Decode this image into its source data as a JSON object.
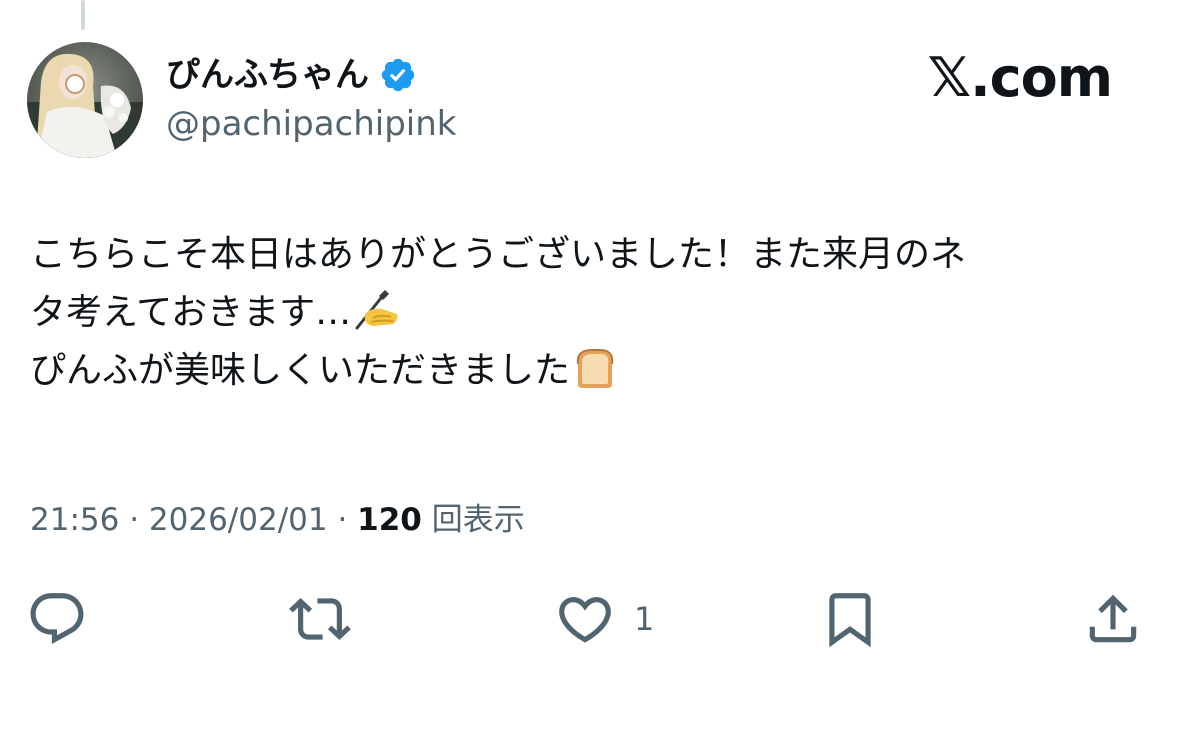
{
  "tweet": {
    "display_name": "ぴんふちゃん",
    "handle": "@pachipachipink",
    "brand": "𝕏.com",
    "lines": [
      "こちらこそ本日はありがとうございました！また来月のネ",
      "タ考えておきます…",
      "ぴんふが美味しくいただきました"
    ],
    "time": "21:56",
    "sep1": " · ",
    "date": "2026/02/01",
    "sep2": " · ",
    "views_count": "120",
    "views_label": " 回表示"
  },
  "actions": {
    "like_count": "1"
  },
  "icons": {
    "verified": "verified-badge-icon",
    "writing_hand": "writing-hand-emoji",
    "bread": "bread-emoji",
    "reply": "reply-icon",
    "retweet": "retweet-icon",
    "like": "heart-icon",
    "bookmark": "bookmark-icon",
    "share": "share-icon"
  },
  "colors": {
    "text": "#0f1419",
    "secondary": "#536471",
    "verified": "#1d9bf0"
  }
}
